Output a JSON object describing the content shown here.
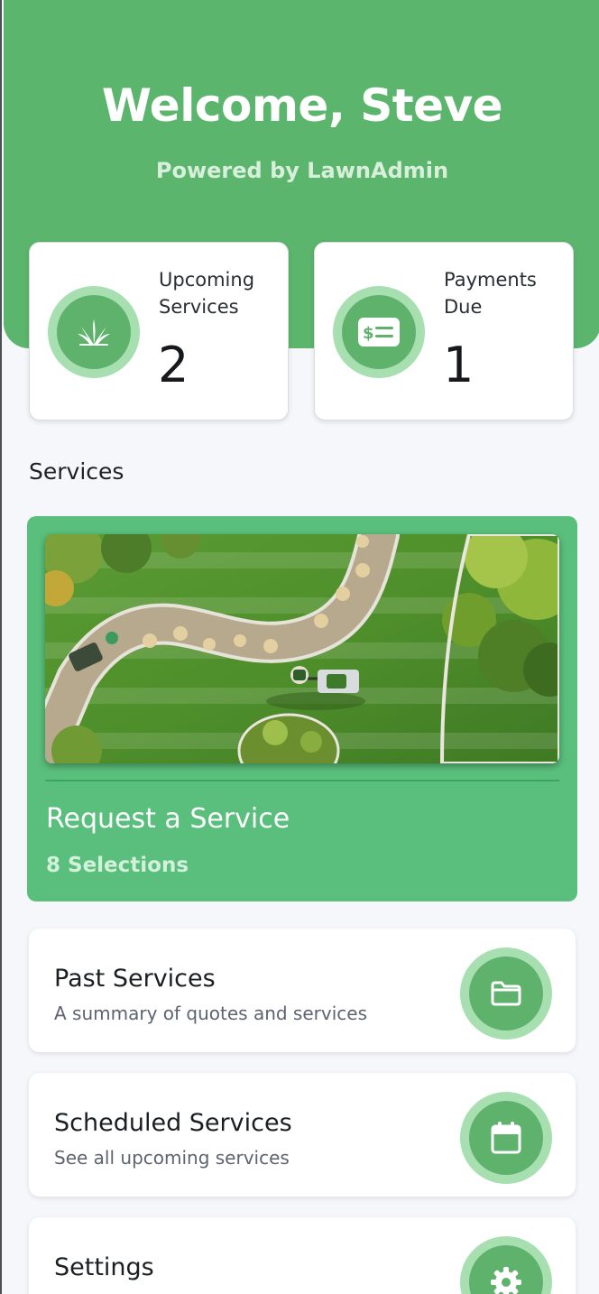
{
  "header": {
    "welcome": "Welcome, Steve",
    "powered_by": "Powered by LawnAdmin"
  },
  "stats": [
    {
      "label": "Upcoming Services",
      "value": "2",
      "icon": "grass-icon"
    },
    {
      "label": "Payments Due",
      "value": "1",
      "icon": "bill-icon"
    }
  ],
  "services_section": {
    "title": "Services"
  },
  "request_service": {
    "title": "Request a Service",
    "subtitle": "8 Selections"
  },
  "menu": [
    {
      "title": "Past Services",
      "subtitle": "A summary of quotes and services",
      "icon": "folder-icon"
    },
    {
      "title": "Scheduled Services",
      "subtitle": "See all upcoming services",
      "icon": "calendar-icon"
    },
    {
      "title": "Settings",
      "subtitle": "",
      "icon": "gear-icon"
    }
  ],
  "colors": {
    "brand_green": "#5cb56c",
    "icon_ring": "#a7dfb0",
    "request_card": "#5abf7c",
    "background": "#f6f7fb"
  }
}
